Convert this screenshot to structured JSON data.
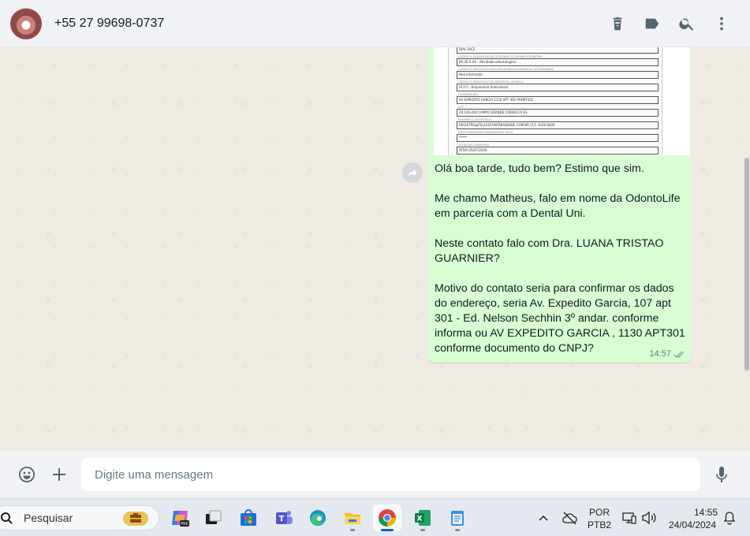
{
  "header": {
    "contact_name": "+55 27 99698-0737"
  },
  "document_preview": {
    "rows": [
      {
        "label": "",
        "value": "DIAL FACE"
      },
      {
        "label": "CODIGO E DESCRICAO DA ATIVIDADE ECONOMICA PRINCIPAL",
        "value": "86.30-5-04 - Atividade odontologica"
      },
      {
        "label": "CODIGO E DESCRICAO DAS ATIVIDADES ECONOMICAS SECUNDARIAS",
        "value": "Nao informada"
      },
      {
        "label": "CODIGO E DESCRICAO DA NATUREZA JURIDICA",
        "value": "213-5 - Empresario (Individual)"
      },
      {
        "label": "LOGRADOURO",
        "value": "AV EXPEDITO GARCIA      1130      APT 301 PAVMT101"
      },
      {
        "label": "CEP",
        "value": "29.146-200      CAMPO GRANDE      CARIACICA      ES"
      },
      {
        "label": "ENDERECO ELETRONICO",
        "value": "REGISTRO@TELLESCONTABILIDADE.COM.BR      (27) 3226-0626"
      },
      {
        "label": "ENTE FEDERATIVO RESPONSAVEL (EFR)",
        "value": "*****"
      },
      {
        "label": "SITUACAO CADASTRAL",
        "value": "ATIVA      05/07/2016"
      }
    ]
  },
  "message": {
    "text": "Olá boa tarde, tudo bem? Estimo que sim.\n\nMe chamo Matheus, falo em nome da OdontoLife em parceria com a Dental Uni.\n\nNeste contato falo com Dra. LUANA TRISTAO GUARNIER?\n\nMotivo do contato seria para confirmar os dados do endereço, seria Av. Expedito Garcia, 107 apt 301 - Ed. Nelson Sechhin 3º andar. conforme informa ou AV EXPEDITO GARCIA , 1130 APT301 conforme documento do CNPJ?",
    "time": "14:57",
    "status_icon": "double-check-icon"
  },
  "composer": {
    "placeholder": "Digite uma mensagem"
  },
  "taskbar": {
    "search_label": "Pesquisar",
    "language_line1": "POR",
    "language_line2": "PTB2",
    "time": "14:55",
    "date": "24/04/2024",
    "apps": [
      "copilot-icon",
      "task-view-icon",
      "microsoft-store-icon",
      "teams-icon",
      "edge-icon",
      "file-explorer-icon",
      "chrome-icon",
      "excel-icon",
      "notepad-icon"
    ]
  },
  "colors": {
    "bubble_out": "#d9fdd3",
    "chat_bg": "#efeae2",
    "header_bg": "#f0f2f5",
    "icon_gray": "#54656f",
    "meta_gray": "#667781"
  }
}
